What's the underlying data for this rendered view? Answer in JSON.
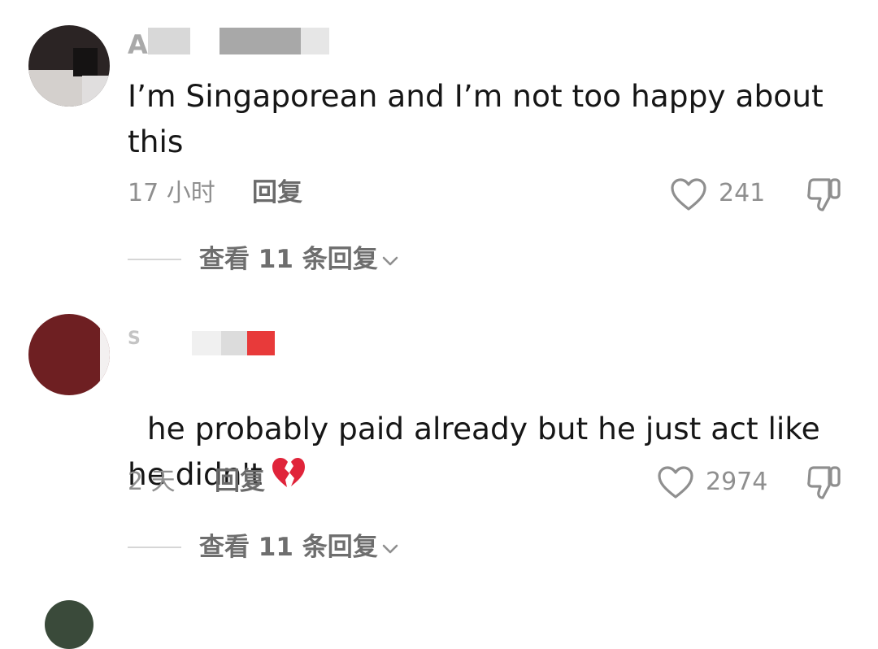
{
  "comments": [
    {
      "username": "A",
      "text": "I’m Singaporean and I’m not too happy about\nthis",
      "time": "17 小时",
      "reply_label": "回复",
      "likes": "241",
      "view_replies": "查看 11 条回复"
    },
    {
      "username": "S",
      "text": "he probably paid already but he just act like\nhe didn't",
      "time": "2 天",
      "reply_label": "回复",
      "likes": "2974",
      "view_replies": "查看 11 条回复"
    }
  ],
  "icons": {
    "like": "heart-outline-icon",
    "dislike": "thumbs-down-icon",
    "expand": "chevron-down-icon",
    "emoji": "broken-heart-emoji"
  },
  "colors": {
    "text": "#161616",
    "muted": "#8f8f8f",
    "emoji_red": "#e0243a"
  }
}
